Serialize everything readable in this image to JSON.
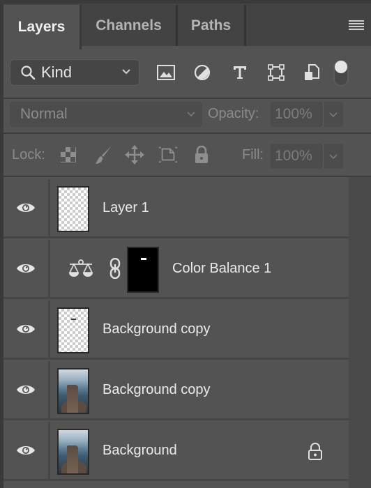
{
  "tabs": [
    {
      "label": "Layers",
      "active": true
    },
    {
      "label": "Channels",
      "active": false
    },
    {
      "label": "Paths",
      "active": false
    }
  ],
  "panel_menu_icon": "hamburger-icon",
  "filter": {
    "kind_label": "Kind",
    "filter_icons": [
      "image-filter-icon",
      "adjustment-filter-icon",
      "type-filter-icon",
      "shape-filter-icon",
      "smart-object-filter-icon"
    ],
    "toggle_on": true
  },
  "blend": {
    "mode": "Normal",
    "opacity_label": "Opacity:",
    "opacity_value": "100%"
  },
  "lock": {
    "label": "Lock:",
    "icons": [
      "lock-transparent-pixels-icon",
      "lock-image-pixels-icon",
      "lock-position-icon",
      "lock-artboard-icon",
      "lock-all-icon"
    ],
    "fill_label": "Fill:",
    "fill_value": "100%"
  },
  "layers": [
    {
      "name": "Layer 1",
      "visible": true,
      "thumb": "transparent",
      "locked": false
    },
    {
      "name": "Color Balance 1",
      "visible": true,
      "thumb": "adjustment-mask",
      "adjustment": "color-balance",
      "locked": false
    },
    {
      "name": "Background copy",
      "visible": true,
      "thumb": "transparent-small",
      "locked": false
    },
    {
      "name": "Background copy",
      "visible": true,
      "thumb": "photo",
      "locked": false
    },
    {
      "name": "Background",
      "visible": true,
      "thumb": "photo",
      "locked": true
    }
  ]
}
